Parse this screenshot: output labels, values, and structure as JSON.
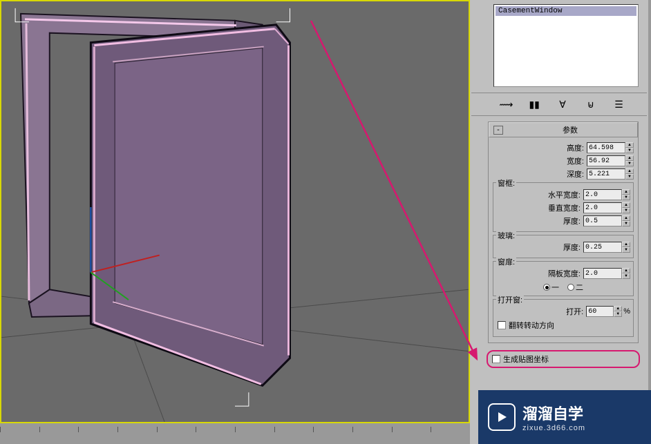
{
  "objectList": {
    "selected": "CasementWindow"
  },
  "rollout": {
    "title": "参数",
    "collapseIcon": "-"
  },
  "dims": {
    "heightLabel": "高度:",
    "heightValue": "64.598",
    "widthLabel": "宽度:",
    "widthValue": "56.92",
    "depthLabel": "深度:",
    "depthValue": "5.221"
  },
  "frame": {
    "groupTitle": "窗框:",
    "hWidthLabel": "水平宽度:",
    "hWidthValue": "2.0",
    "vWidthLabel": "垂直宽度:",
    "vWidthValue": "2.0",
    "thickLabel": "厚度:",
    "thickValue": "0.5"
  },
  "glass": {
    "groupTitle": "玻璃:",
    "thickLabel": "厚度:",
    "thickValue": "0.25"
  },
  "casement": {
    "groupTitle": "窗扉:",
    "panelWidthLabel": "隔板宽度:",
    "panelWidthValue": "2.0",
    "radioOne": "一",
    "radioTwo": "二"
  },
  "open": {
    "groupTitle": "打开窗:",
    "openLabel": "打开:",
    "openValue": "60",
    "percent": "%",
    "flipLabel": "翻转转动方向"
  },
  "mapCoords": {
    "label": "生成贴图坐标"
  },
  "watermark": {
    "main": "溜溜自学",
    "sub": "zixue.3d66.com"
  }
}
